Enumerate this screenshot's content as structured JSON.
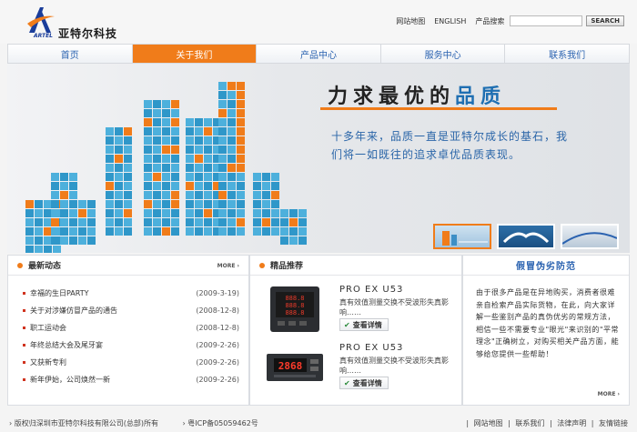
{
  "brand": {
    "name_cn": "亚特尔科技",
    "name_en": "ARTEL",
    "accent": "#f07c1a",
    "blue": "#2a62b0"
  },
  "top_links": {
    "sitemap": "网站地图",
    "english": "ENGLISH",
    "search_label": "产品搜索",
    "search_button": "SEARCH",
    "search_value": ""
  },
  "nav": [
    {
      "label": "首页",
      "active": false
    },
    {
      "label": "关于我们",
      "active": true
    },
    {
      "label": "产品中心",
      "active": false
    },
    {
      "label": "服务中心",
      "active": false
    },
    {
      "label": "联系我们",
      "active": false
    }
  ],
  "banner": {
    "title_a": "力求最优的",
    "title_b": "品质",
    "desc": "十多年来，品质一直是亚特尔成长的基石，我们将一如既往的追求卓优品质表现。"
  },
  "news": {
    "heading": "最新动态",
    "more": "MORE",
    "items": [
      {
        "title": "幸福的生日PARTY",
        "date": "(2009-3-19)"
      },
      {
        "title": "关于对涉嫌仿冒产品的通告",
        "date": "(2008-12-8)"
      },
      {
        "title": "职工运动会",
        "date": "(2008-12-8)"
      },
      {
        "title": "年终总结大会及尾牙宴",
        "date": "(2009-2-26)"
      },
      {
        "title": "又获新专利",
        "date": "(2009-2-26)"
      },
      {
        "title": "新年伊始，公司焕然一新",
        "date": "(2009-2-26)"
      }
    ]
  },
  "products": {
    "heading": "精品推荐",
    "items": [
      {
        "name": "PRO EX U53",
        "desc": "真有效值测量交换不受波形失真影响……",
        "button": "查看详情",
        "display": "888.8"
      },
      {
        "name": "PRO EX U53",
        "desc": "真有效值测量交换不受波形失真影响……",
        "button": "查看详情",
        "display": "2868"
      }
    ]
  },
  "anti_fake": {
    "heading": "假冒伪劣防范",
    "text": "由于很多产品是在异地购买，消费者很难亲自检索产品实际货物，在此，向大家详解一些鉴别产品的真伪优劣的常规方法，相信一些不需要专业\"眼光\"来识别的\"平常理念\"正确树立，对购买相关产品方面，能够给您提供一些帮助！",
    "more": "MORE"
  },
  "footer": {
    "copyright": "版权归深圳市亚特尔科技有限公司(总部)所有",
    "icp": "粤ICP备05059462号",
    "links": [
      "网站地图",
      "联系我们",
      "法律声明",
      "友情链接"
    ]
  }
}
